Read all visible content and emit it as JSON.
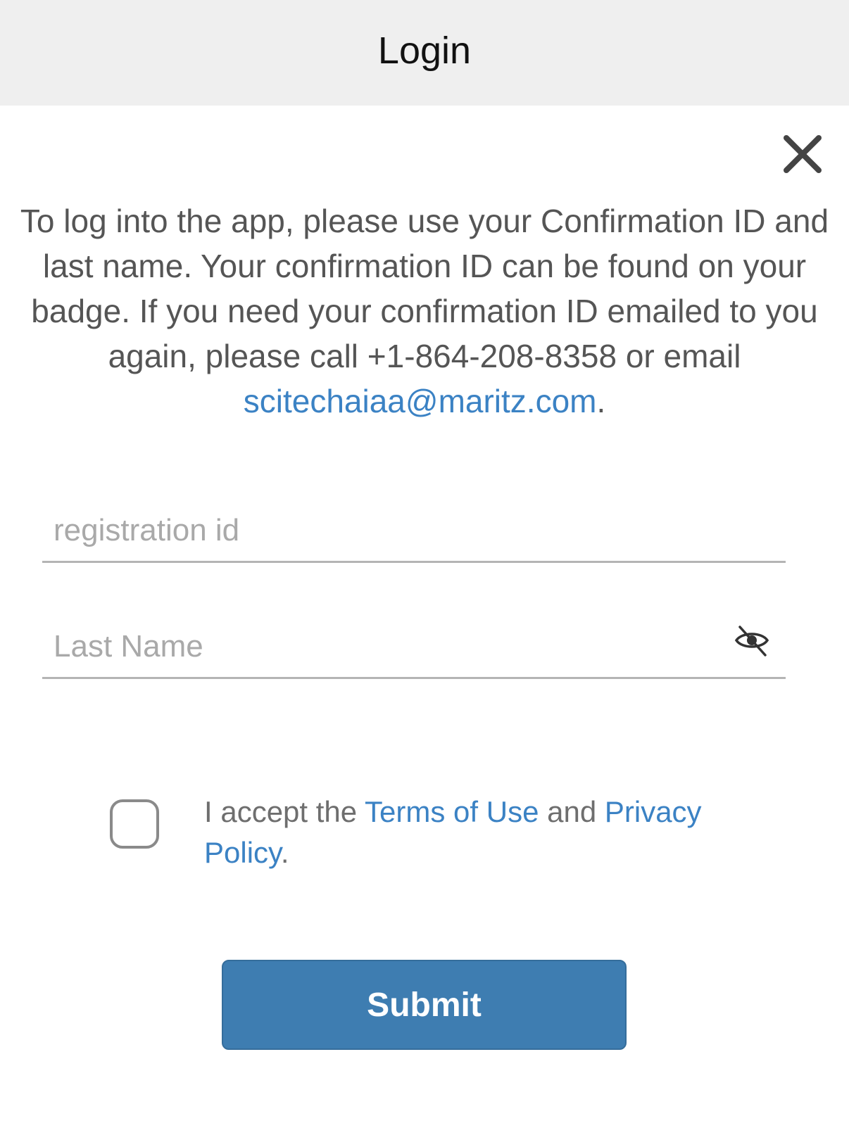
{
  "header": {
    "title": "Login"
  },
  "intro": {
    "text": "To log into the app, please use your Confirmation ID and last name. Your confirmation ID can be found on your badge. If you need your confirmation ID emailed to you again, please call +1-864-208-8358 or email ",
    "email_link": "scitechaiaa@maritz.com",
    "trailing": "."
  },
  "form": {
    "registration_id": {
      "placeholder": "registration id",
      "value": ""
    },
    "last_name": {
      "placeholder": "Last Name",
      "value": ""
    },
    "password_visibility_icon": "eye-slash-icon"
  },
  "terms": {
    "checked": false,
    "prefix": "I accept the ",
    "terms_link": "Terms of Use",
    "middle": " and ",
    "privacy_link": "Privacy Policy",
    "suffix": "."
  },
  "submit_label": "Submit",
  "colors": {
    "header_bg": "#efefef",
    "link": "#3b82c4",
    "button": "#3e7db1",
    "body_text": "#555555"
  }
}
